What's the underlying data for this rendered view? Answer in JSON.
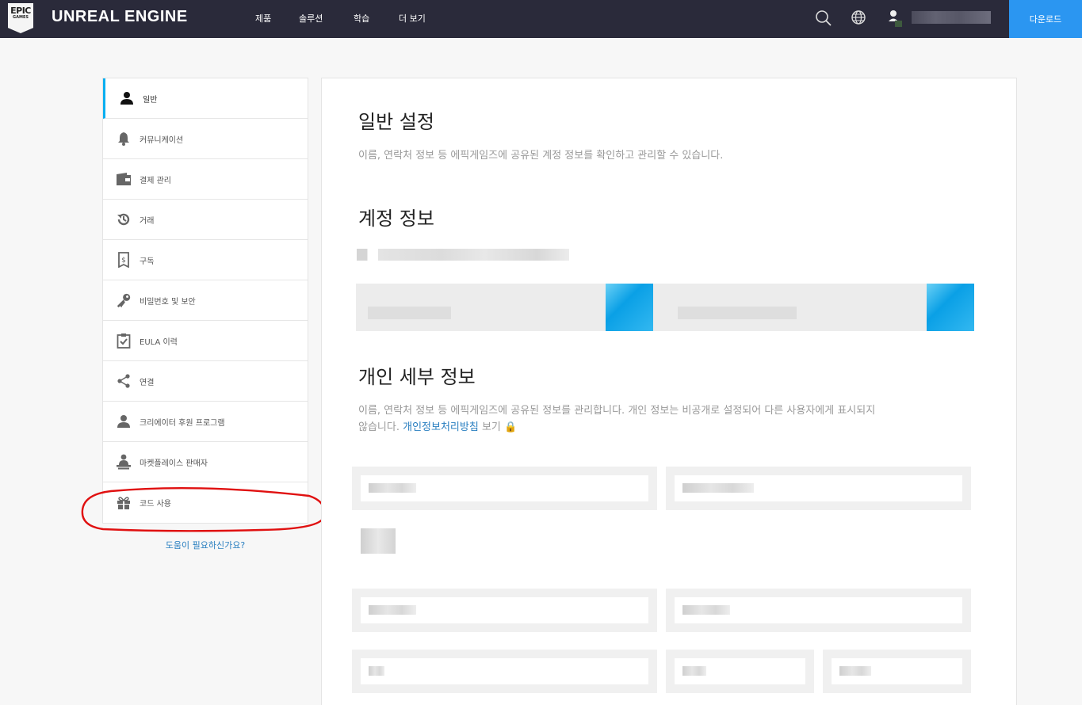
{
  "topnav": {
    "logo_line1": "EPIC",
    "logo_line2": "GAMES",
    "title": "UNREAL ENGINE",
    "items": [
      {
        "label": "제품"
      },
      {
        "label": "솔루션"
      },
      {
        "label": "학습"
      },
      {
        "label": "더 보기"
      }
    ],
    "search_icon": "search-icon",
    "language_icon": "globe-icon",
    "user_icon": "user-icon",
    "download_label": "다운로드"
  },
  "sidebar": {
    "items": [
      {
        "label": "일반",
        "icon": "person-icon",
        "active": true
      },
      {
        "label": "커뮤니케이션",
        "icon": "bell-icon"
      },
      {
        "label": "결제 관리",
        "icon": "wallet-icon"
      },
      {
        "label": "거래",
        "icon": "history-icon"
      },
      {
        "label": "구독",
        "icon": "receipt-icon"
      },
      {
        "label": "비밀번호 및 보안",
        "icon": "key-icon"
      },
      {
        "label": "EULA 이력",
        "icon": "clipboard-check-icon"
      },
      {
        "label": "연결",
        "icon": "share-icon"
      },
      {
        "label": "크리에이터 후원 프로그램",
        "icon": "person-icon"
      },
      {
        "label": "마켓플레이스 판매자",
        "icon": "seller-icon"
      },
      {
        "label": "코드 사용",
        "icon": "gift-icon"
      }
    ],
    "help_link": "도움이 필요하신가요?"
  },
  "main": {
    "general_title": "일반 설정",
    "general_desc": "이름, 연락처 정보 등 에픽게임즈에 공유된 계정 정보를 확인하고 관리할 수 있습니다.",
    "account_title": "계정 정보",
    "personal_title": "개인 세부 정보",
    "personal_desc_1": "이름, 연락처 정보 등 에픽게임즈에 공유된 정보를 관리합니다. 개인 정보는 비공개로 설정되어 다른 사용자에게 표시되지",
    "personal_desc_2": "않습니다.",
    "privacy_link": "개인정보처리방침",
    "privacy_suffix": "보기",
    "lock_icon": "lock-icon"
  },
  "colors": {
    "nav_bg": "#2a2a3a",
    "accent": "#0aaff1",
    "download_bg": "#2b96f1",
    "link": "#2a7fc0",
    "annotation": "#e01010"
  }
}
